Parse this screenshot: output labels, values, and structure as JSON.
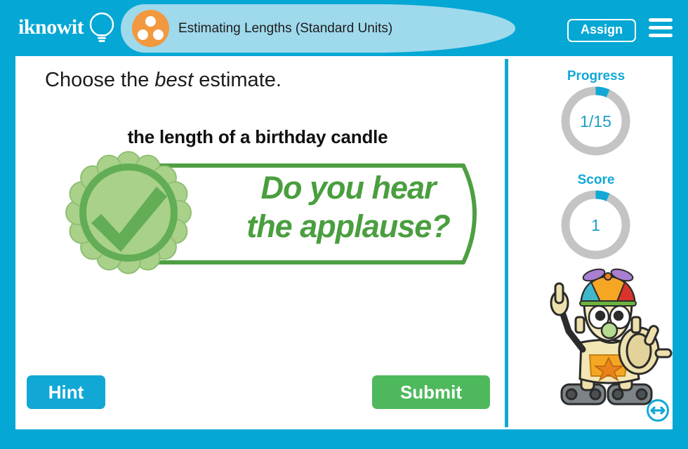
{
  "brand": {
    "logo_text": "iknowit",
    "logo_icon": "lightbulb-icon"
  },
  "header": {
    "title": "Estimating Lengths (Standard Units)",
    "title_icon": "three-dots-circle-icon",
    "assign_label": "Assign",
    "menu_icon": "hamburger-menu-icon",
    "background_color": "#05a7d4",
    "title_bar_color": "#9fd9ec",
    "title_icon_color": "#f2983e"
  },
  "question": {
    "prompt_before": "Choose the ",
    "prompt_emphasis": "best",
    "prompt_after": " estimate.",
    "text": "the length of a birthday candle"
  },
  "feedback": {
    "line1": "Do you hear",
    "line2": "the applause?",
    "icon": "check-badge-icon",
    "accent_color": "#4a9e3f",
    "badge_fill": "#a9d18a",
    "badge_ring": "#62ad55"
  },
  "sidebar": {
    "progress": {
      "label": "Progress",
      "value": "1/15",
      "current": 1,
      "total": 15,
      "fill_color": "#12a8d6",
      "track_color": "#c4c4c4"
    },
    "score": {
      "label": "Score",
      "value": "1",
      "current": 1,
      "total": 15,
      "fill_color": "#12a8d6",
      "track_color": "#c4c4c4"
    },
    "mascot": "robot-mascot-icon",
    "resize_icon": "resize-horizontal-icon"
  },
  "actions": {
    "hint_label": "Hint",
    "hint_color": "#12a8d6",
    "submit_label": "Submit",
    "submit_color": "#4eb95c"
  }
}
